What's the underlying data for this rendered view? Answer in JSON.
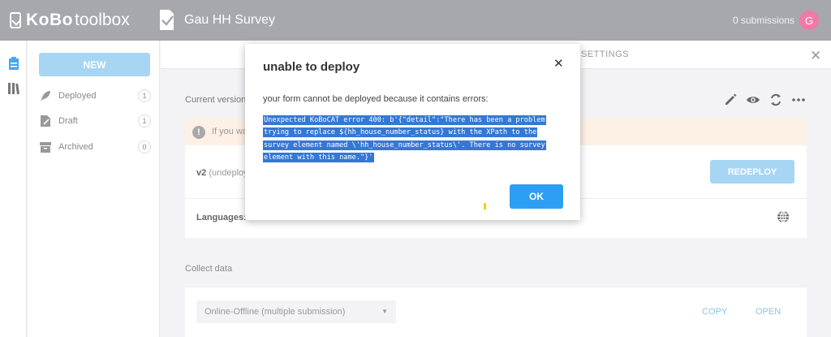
{
  "header": {
    "logo_kobo": "KoBo",
    "logo_toolbox": "toolbox",
    "project_title": "Gau HH Survey",
    "submissions": "0 submissions",
    "avatar_initial": "G"
  },
  "sidebar": {
    "new_label": "NEW",
    "items": [
      {
        "label": "Deployed",
        "count": "1"
      },
      {
        "label": "Draft",
        "count": "1"
      },
      {
        "label": "Archived",
        "count": "0"
      }
    ]
  },
  "main": {
    "tab_settings": "SETTINGS",
    "current_version": "Current version",
    "warning_text": "If you wa",
    "version_label": "v2",
    "version_status": "(undeploy",
    "redeploy_label": "REDEPLOY",
    "languages_label": "Languages:",
    "collect_label": "Collect data",
    "collect_select": "Online-Offline (multiple submission)",
    "copy_label": "COPY",
    "open_label": "OPEN"
  },
  "modal": {
    "title": "unable to deploy",
    "message": "your form cannot be deployed because it contains errors:",
    "error_text": "Unexpected KoBoCAT error 400: b'{\"detail\":\"There has been a problem trying to replace ${hh_house_number_status} with the XPath to the survey element named \\'hh_house_number_status\\'. There is no survey element with this name.\"}'",
    "ok_label": "OK"
  },
  "colors": {
    "header_bg": "#a7a8ad",
    "primary_button": "#2d9ff2",
    "disabled_button": "#a6d6f4",
    "selection": "#3478d6",
    "warning_bg": "#fdf1e6",
    "avatar": "#f07aa8"
  }
}
